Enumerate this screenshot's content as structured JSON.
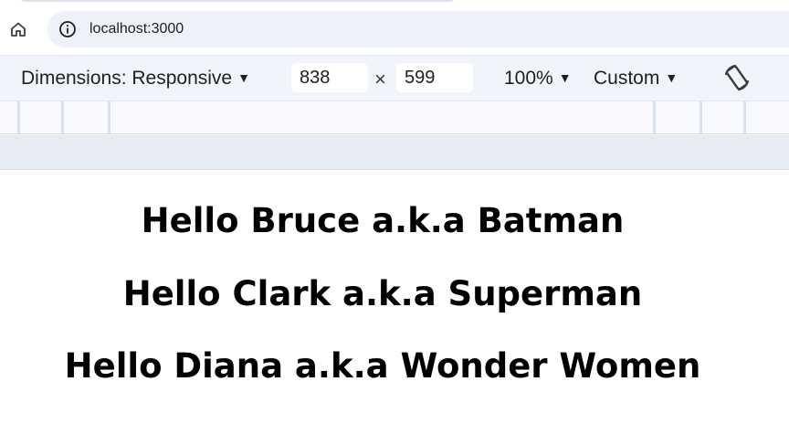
{
  "browser": {
    "url": "localhost:3000"
  },
  "device_toolbar": {
    "dimensions_label": "Dimensions: Responsive",
    "width_value": "838",
    "height_value": "599",
    "times_symbol": "×",
    "zoom_label": "100%",
    "throttle_label": "Custom",
    "caret": "▼"
  },
  "icons": {
    "home": "home-icon",
    "info": "info-icon",
    "rotate": "rotate-icon",
    "caret": "caret-down-icon"
  },
  "page": {
    "greetings": [
      "Hello Bruce a.k.a Batman",
      "Hello Clark a.k.a Superman",
      "Hello Diana a.k.a Wonder Women"
    ]
  }
}
